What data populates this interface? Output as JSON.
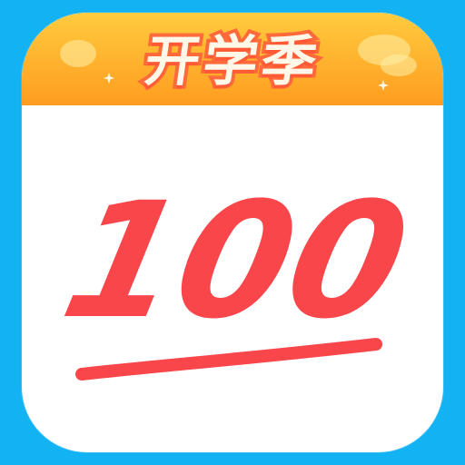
{
  "app_icon": {
    "banner_title": "开学季",
    "score": "100",
    "colors": {
      "outer_bg": "#12b2f3",
      "card_bg": "#ffffff",
      "banner_top": "#ffcb3f",
      "banner_bottom": "#ff9d21",
      "banner_text": "#fff8e8",
      "banner_outline": "#ff6a3b",
      "score_red": "#f9464a"
    },
    "underline_icon": "handwritten-underline-icon"
  }
}
